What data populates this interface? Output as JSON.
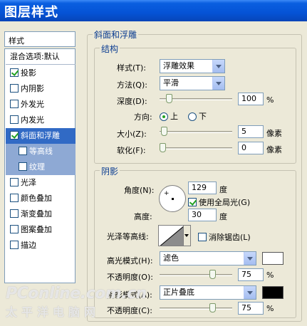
{
  "window": {
    "title": "图层样式"
  },
  "sidebar": {
    "header": "样式",
    "blend_options": "混合选项:默认",
    "items": [
      {
        "label": "投影",
        "checked": true
      },
      {
        "label": "内阴影",
        "checked": false
      },
      {
        "label": "外发光",
        "checked": false
      },
      {
        "label": "内发光",
        "checked": false
      },
      {
        "label": "斜面和浮雕",
        "checked": true,
        "selected": true
      },
      {
        "label": "等高线",
        "checked": false,
        "sub": true
      },
      {
        "label": "纹理",
        "checked": false,
        "sub": true
      },
      {
        "label": "光泽",
        "checked": false
      },
      {
        "label": "颜色叠加",
        "checked": false
      },
      {
        "label": "渐变叠加",
        "checked": false
      },
      {
        "label": "图案叠加",
        "checked": false
      },
      {
        "label": "描边",
        "checked": false
      }
    ]
  },
  "panel": {
    "section_title": "斜面和浮雕",
    "structure": {
      "title": "结构",
      "style_label": "样式(T):",
      "style_value": "浮雕效果",
      "technique_label": "方法(Q):",
      "technique_value": "平滑",
      "depth_label": "深度(D):",
      "depth_value": "100",
      "depth_unit": "%",
      "depth_level": 0.1,
      "direction_label": "方向:",
      "direction_up": "上",
      "direction_down": "下",
      "size_label": "大小(Z):",
      "size_value": "5",
      "size_unit": "像素",
      "size_level": 0.02,
      "soften_label": "软化(F):",
      "soften_value": "0",
      "soften_unit": "像素",
      "soften_level": 0.0
    },
    "shading": {
      "title": "阴影",
      "angle_label": "角度(N):",
      "angle_value": "129",
      "angle_unit": "度",
      "global_light_label": "使用全局光(G)",
      "global_light_checked": true,
      "altitude_label": "高度:",
      "altitude_value": "30",
      "altitude_unit": "度",
      "gloss_contour_label": "光泽等高线:",
      "anti_alias_label": "消除锯齿(L)",
      "anti_alias_checked": false,
      "highlight_mode_label": "高光模式(H):",
      "highlight_mode_value": "滤色",
      "highlight_color": "#ffffff",
      "highlight_opacity_label": "不透明度(O):",
      "highlight_opacity_value": "75",
      "highlight_opacity_unit": "%",
      "highlight_opacity_level": 0.75,
      "shadow_mode_label": "阴影模式(A):",
      "shadow_mode_value": "正片叠底",
      "shadow_color": "#000000",
      "shadow_opacity_label": "不透明度(C):",
      "shadow_opacity_value": "75",
      "shadow_opacity_unit": "%",
      "shadow_opacity_level": 0.75
    }
  },
  "watermark": {
    "line1": "PConline.com.cn",
    "line2": "太平洋电脑网"
  },
  "colors": {
    "selected": "#316ac5",
    "sub_item": "#8ea9d4",
    "title_bar": "#0553d6"
  }
}
